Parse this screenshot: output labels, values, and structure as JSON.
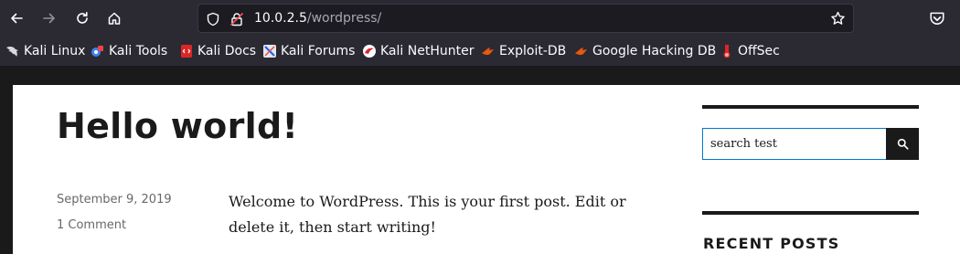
{
  "browser": {
    "url_host": "10.0.2.5",
    "url_path": "/wordpress/",
    "nav_icons": [
      "back-arrow-icon",
      "forward-arrow-icon",
      "reload-icon",
      "home-icon"
    ],
    "bookmarks": [
      {
        "label": "Kali Linux",
        "icon": "kali-dragon-icon"
      },
      {
        "label": "Kali Tools",
        "icon": "kali-tools-icon"
      },
      {
        "label": "Kali Docs",
        "icon": "kali-docs-icon"
      },
      {
        "label": "Kali Forums",
        "icon": "kali-forums-icon"
      },
      {
        "label": "Kali NetHunter",
        "icon": "nethunter-icon"
      },
      {
        "label": "Exploit-DB",
        "icon": "exploit-db-icon"
      },
      {
        "label": "Google Hacking DB",
        "icon": "ghdb-icon"
      },
      {
        "label": "OffSec",
        "icon": "offsec-icon"
      }
    ]
  },
  "post": {
    "title": "Hello world!",
    "date": "September 9, 2019",
    "comments": "1 Comment",
    "body": "Welcome to WordPress. This is your first post. Edit or delete it, then start writing!"
  },
  "sidebar": {
    "search_value": "search test",
    "recent_posts_title": "RECENT POSTS"
  },
  "colors": {
    "chrome_bg": "#2b2a33",
    "urlbar_bg": "#1c1b22",
    "page_text": "#1a1a1a",
    "meta_text": "#686868",
    "focus_border": "#007acc"
  }
}
